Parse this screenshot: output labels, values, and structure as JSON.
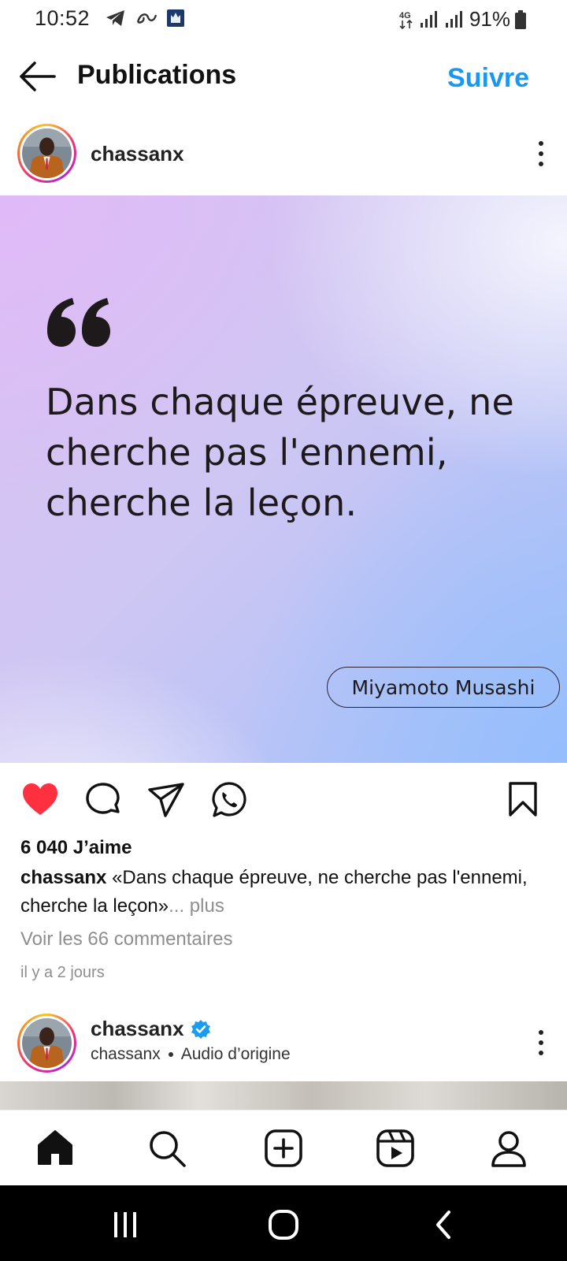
{
  "status_bar": {
    "time": "10:52",
    "battery": "91%",
    "network": "4G",
    "icons_left": [
      "telegram-icon",
      "app-icon",
      "game-icon"
    ],
    "icons_right": [
      "network-4g-icon",
      "signal-icon",
      "signal-icon",
      "battery-icon"
    ]
  },
  "header": {
    "title": "Publications",
    "follow_label": "Suivre"
  },
  "post": {
    "username": "chassanx",
    "image": {
      "quote": "Dans chaque épreuve, ne cherche pas l'ennemi, cherche la leçon.",
      "author": "Miyamoto Musashi"
    },
    "likes": "6 040 J’aime",
    "caption_user": "chassanx",
    "caption_text": "«Dans chaque épreuve, ne cherche pas l'ennemi, cherche la leçon»",
    "caption_more": "... plus",
    "comments_link": "Voir les 66 commentaires",
    "time_ago": "il y a 2 jours",
    "liked": true
  },
  "next_post": {
    "username": "chassanx",
    "verified": true,
    "sub_user": "chassanx",
    "audio": "Audio d’origine"
  },
  "bottom_nav": [
    "home-icon",
    "search-icon",
    "create-icon",
    "reels-icon",
    "profile-icon"
  ],
  "system_nav": [
    "recents-icon",
    "home-button-icon",
    "back-icon"
  ],
  "colors": {
    "accent": "#1a97f0",
    "like": "#ff3040",
    "verified": "#1d9bf0"
  }
}
